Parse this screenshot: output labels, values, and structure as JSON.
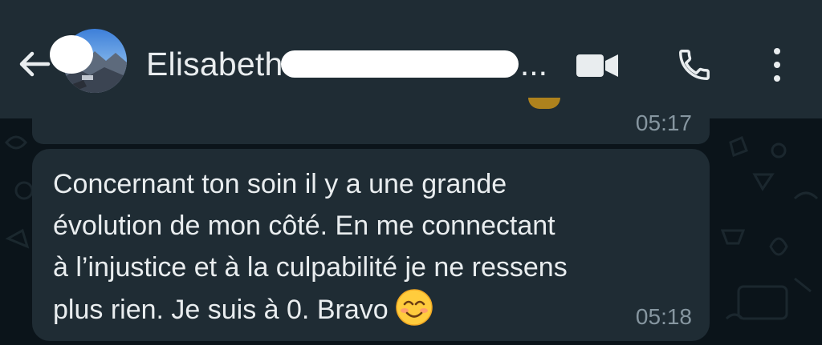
{
  "header": {
    "contact_name_visible": "Elisabeth",
    "ellipsis": "..."
  },
  "messages": [
    {
      "time": "05:17"
    },
    {
      "lines": [
        "Concernant ton soin il y a une grande",
        "évolution de mon côté. En me connectant",
        "à l’injustice et à la culpabilité je ne ressens",
        "plus rien. Je suis à 0. Bravo"
      ],
      "emoji": "smiling-face-with-smiling-eyes",
      "time": "05:18"
    }
  ],
  "icons": {
    "back": "arrow-left-icon",
    "video": "video-camera-icon",
    "call": "phone-icon",
    "menu": "more-vertical-icon"
  },
  "colors": {
    "header_bg": "#1f2c34",
    "chat_bg": "#0b141a",
    "bubble_bg": "#1f2c34",
    "text": "#e9edef",
    "timestamp": "#8696a0"
  }
}
